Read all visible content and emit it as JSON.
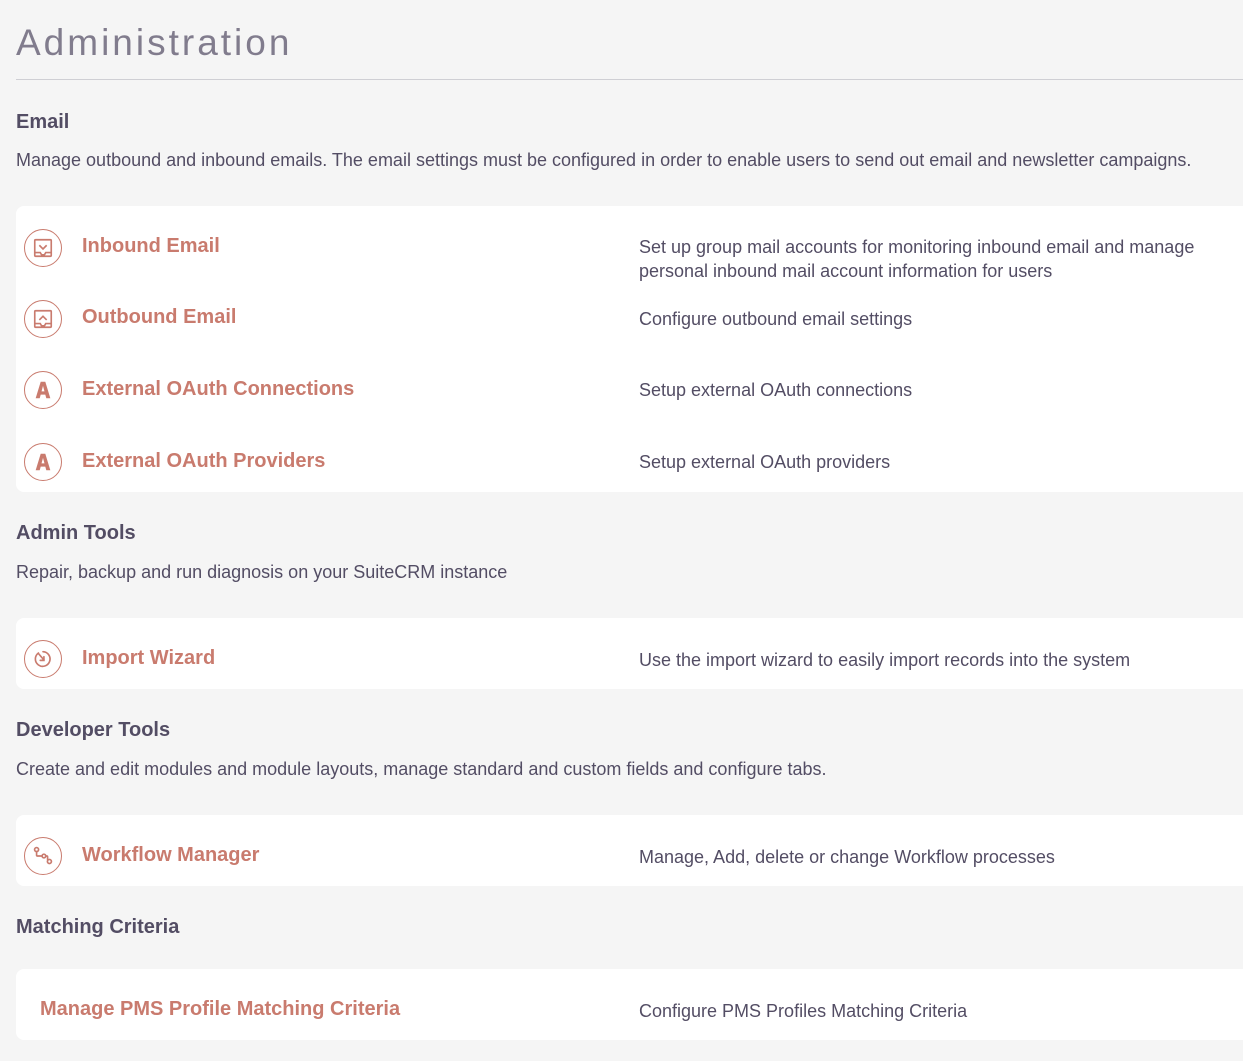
{
  "page": {
    "title": "Administration"
  },
  "sections": [
    {
      "title": "Email",
      "description": "Manage outbound and inbound emails. The email settings must be configured in order to enable users to send out email and newsletter campaigns.",
      "items": [
        {
          "icon": "inbound-email-icon",
          "label": "Inbound Email",
          "description": "Set up group mail accounts for monitoring inbound email and manage personal inbound mail account information for users"
        },
        {
          "icon": "outbound-email-icon",
          "label": "Outbound Email",
          "description": "Configure outbound email settings"
        },
        {
          "icon": "oauth-connections-icon",
          "label": "External OAuth Connections",
          "description": "Setup external OAuth connections"
        },
        {
          "icon": "oauth-providers-icon",
          "label": "External OAuth Providers",
          "description": "Setup external OAuth providers"
        }
      ]
    },
    {
      "title": "Admin Tools",
      "description": "Repair, backup and run diagnosis on your SuiteCRM instance",
      "items": [
        {
          "icon": "import-wizard-icon",
          "label": "Import Wizard",
          "description": "Use the import wizard to easily import records into the system"
        }
      ]
    },
    {
      "title": "Developer Tools",
      "description": "Create and edit modules and module layouts, manage standard and custom fields and configure tabs.",
      "items": [
        {
          "icon": "workflow-icon",
          "label": "Workflow Manager",
          "description": "Manage, Add, delete or change Workflow processes"
        }
      ]
    },
    {
      "title": "Matching Criteria",
      "description": "",
      "items": [
        {
          "icon": "",
          "label": "Manage PMS Profile Matching Criteria",
          "description": "Configure PMS Profiles Matching Criteria"
        }
      ]
    }
  ],
  "colors": {
    "accent": "#c97b6e",
    "text": "#534d64",
    "background": "#f5f5f5",
    "panel": "#ffffff",
    "title": "#817c8d"
  }
}
